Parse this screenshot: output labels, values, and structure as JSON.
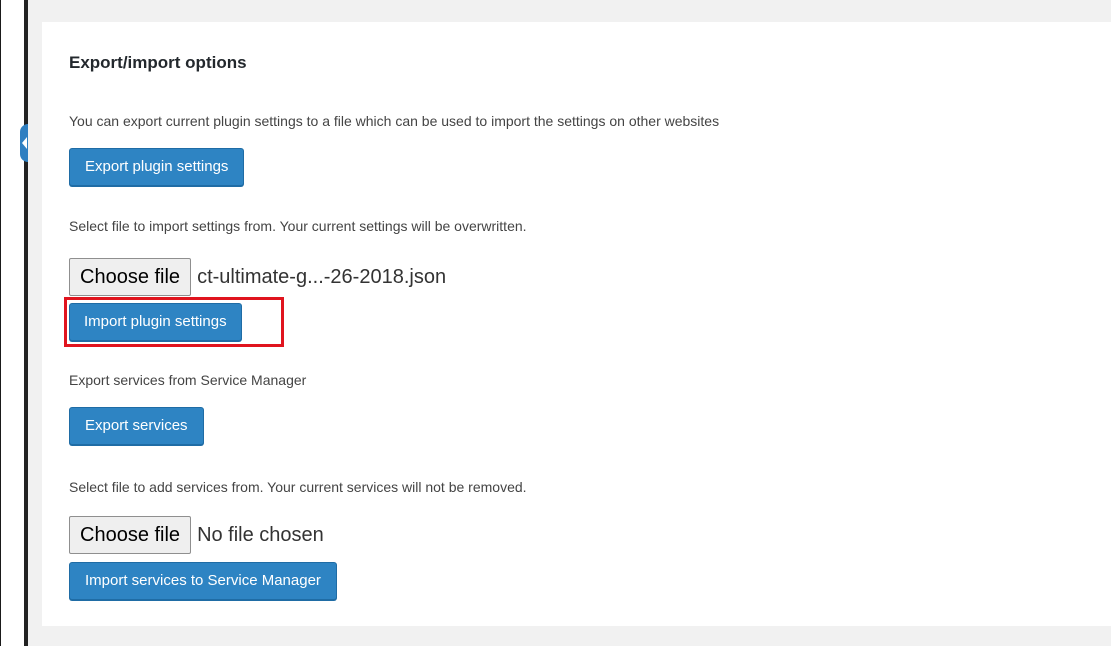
{
  "panel": {
    "title": "Export/import options"
  },
  "export_settings": {
    "description": "You can export current plugin settings to a file which can be used to import the settings on other websites",
    "button_label": "Export plugin settings"
  },
  "import_settings": {
    "description": "Select file to import settings from. Your current settings will be overwritten.",
    "choose_file_label": "Choose file",
    "file_name": "ct-ultimate-g...-26-2018.json",
    "button_label": "Import plugin settings"
  },
  "export_services": {
    "description": "Export services from Service Manager",
    "button_label": "Export services"
  },
  "import_services": {
    "description": "Select file to add services from. Your current services will not be removed.",
    "choose_file_label": "Choose file",
    "file_name": "No file chosen",
    "button_label": "Import services to Service Manager"
  },
  "colors": {
    "primary_button": "#2e84c3",
    "highlight_box": "#e0141e",
    "panel_background": "#ffffff",
    "page_background": "#f1f1f1"
  }
}
